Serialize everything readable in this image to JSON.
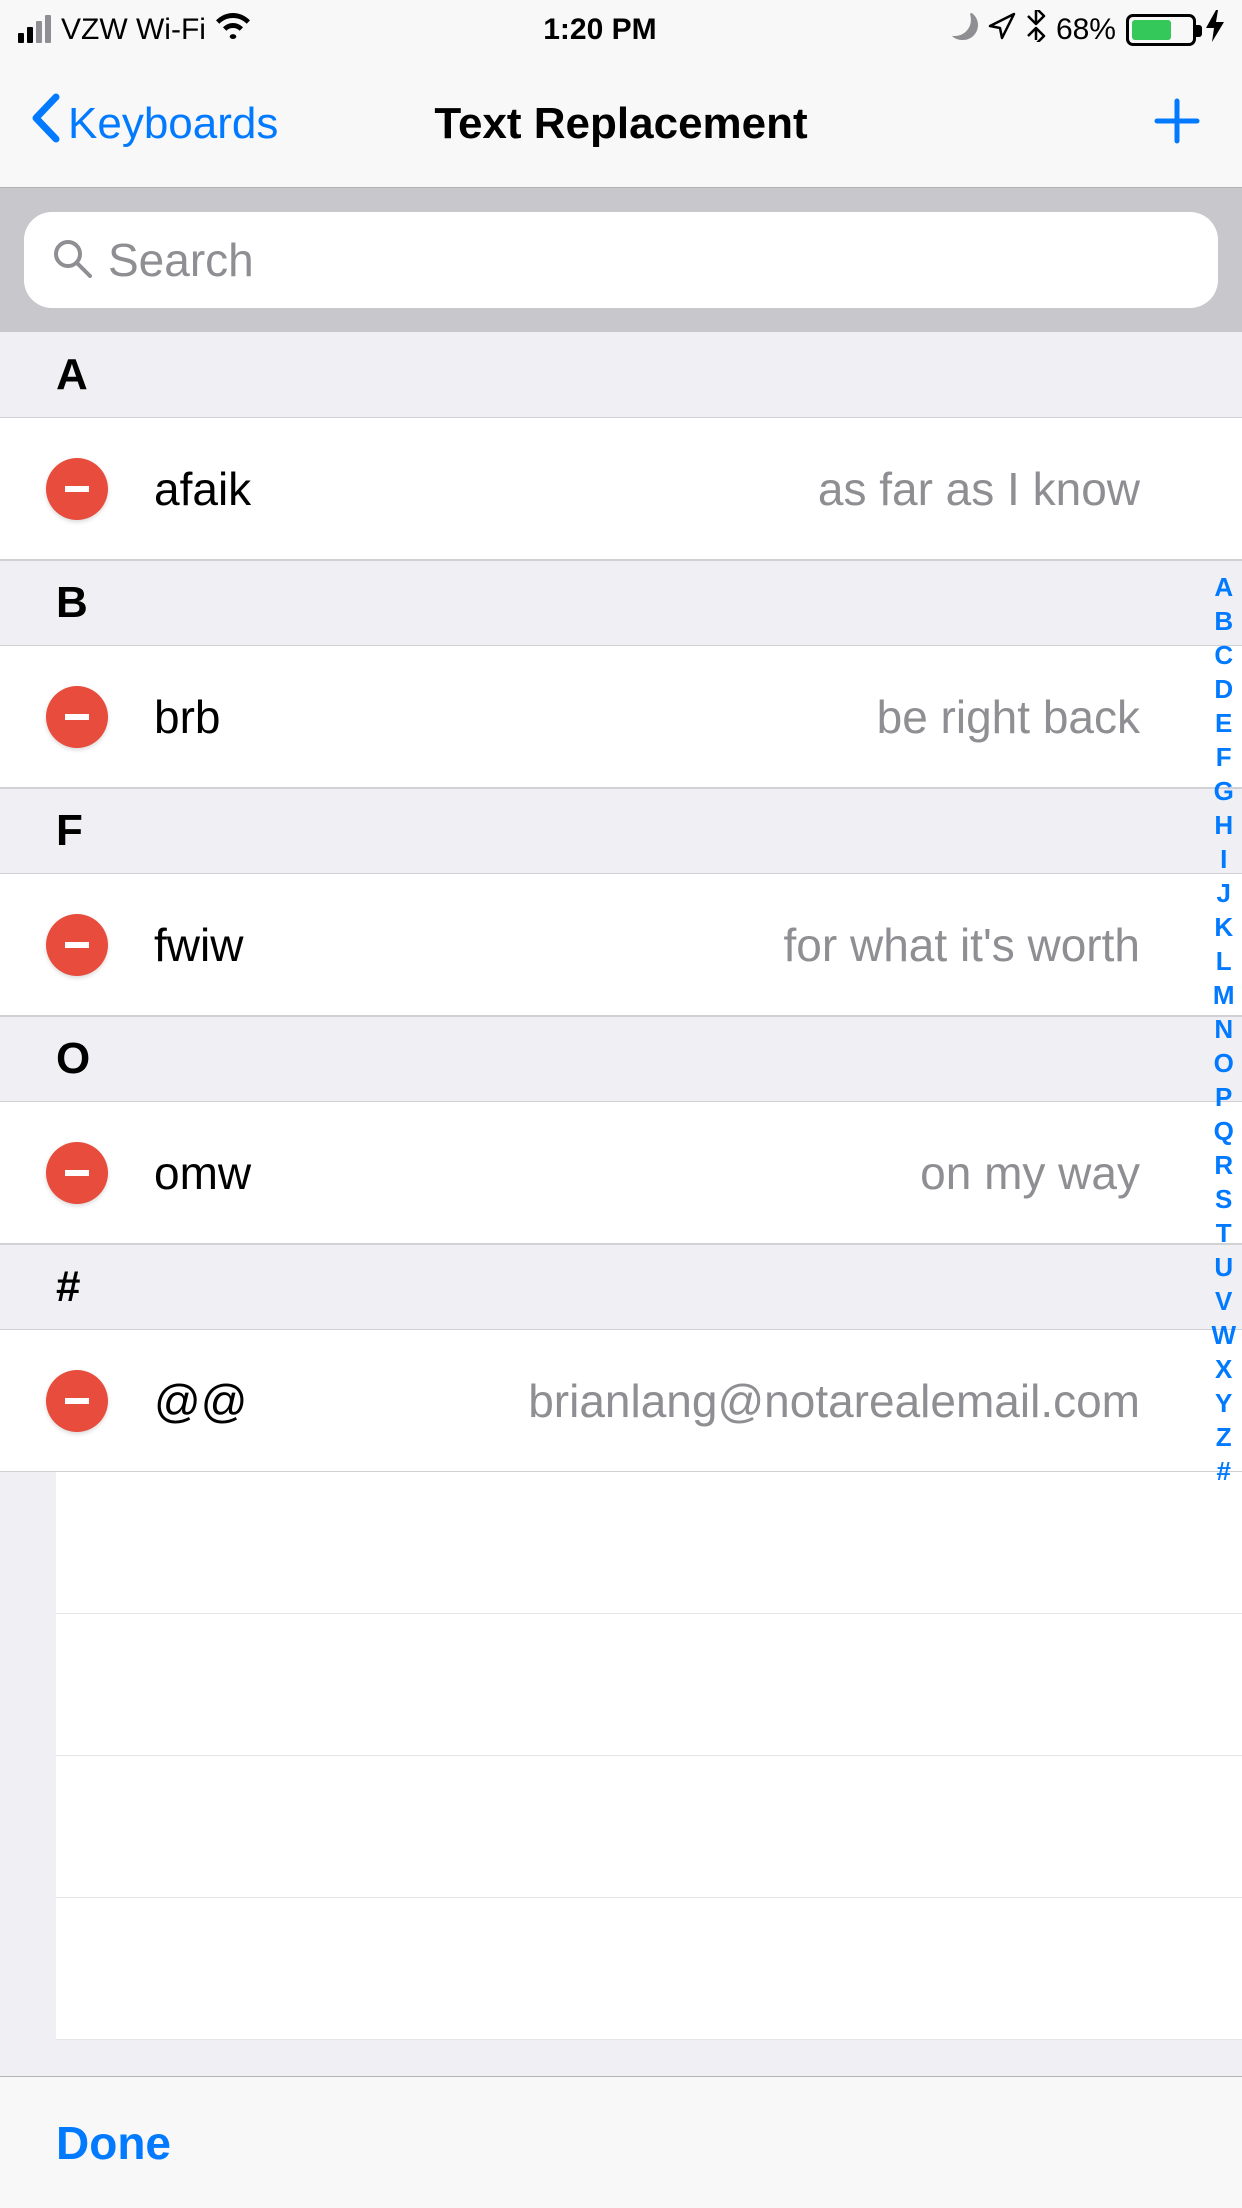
{
  "status_bar": {
    "carrier": "VZW Wi-Fi",
    "time": "1:20 PM",
    "battery_pct": "68%",
    "battery_fill_pct": 68
  },
  "nav": {
    "back_label": "Keyboards",
    "title": "Text Replacement"
  },
  "search": {
    "placeholder": "Search"
  },
  "sections": [
    {
      "key": "A",
      "rows": [
        {
          "shortcut": "afaik",
          "phrase": "as far as I know"
        }
      ]
    },
    {
      "key": "B",
      "rows": [
        {
          "shortcut": "brb",
          "phrase": "be right back"
        }
      ]
    },
    {
      "key": "F",
      "rows": [
        {
          "shortcut": "fwiw",
          "phrase": "for what it's worth"
        }
      ]
    },
    {
      "key": "O",
      "rows": [
        {
          "shortcut": "omw",
          "phrase": "on my way"
        }
      ]
    },
    {
      "key": "#",
      "rows": [
        {
          "shortcut": "@@",
          "phrase": "brianlang@notarealemail.com"
        }
      ]
    }
  ],
  "section_index": [
    "A",
    "B",
    "C",
    "D",
    "E",
    "F",
    "G",
    "H",
    "I",
    "J",
    "K",
    "L",
    "M",
    "N",
    "O",
    "P",
    "Q",
    "R",
    "S",
    "T",
    "U",
    "V",
    "W",
    "X",
    "Y",
    "Z",
    "#"
  ],
  "toolbar": {
    "done_label": "Done"
  }
}
